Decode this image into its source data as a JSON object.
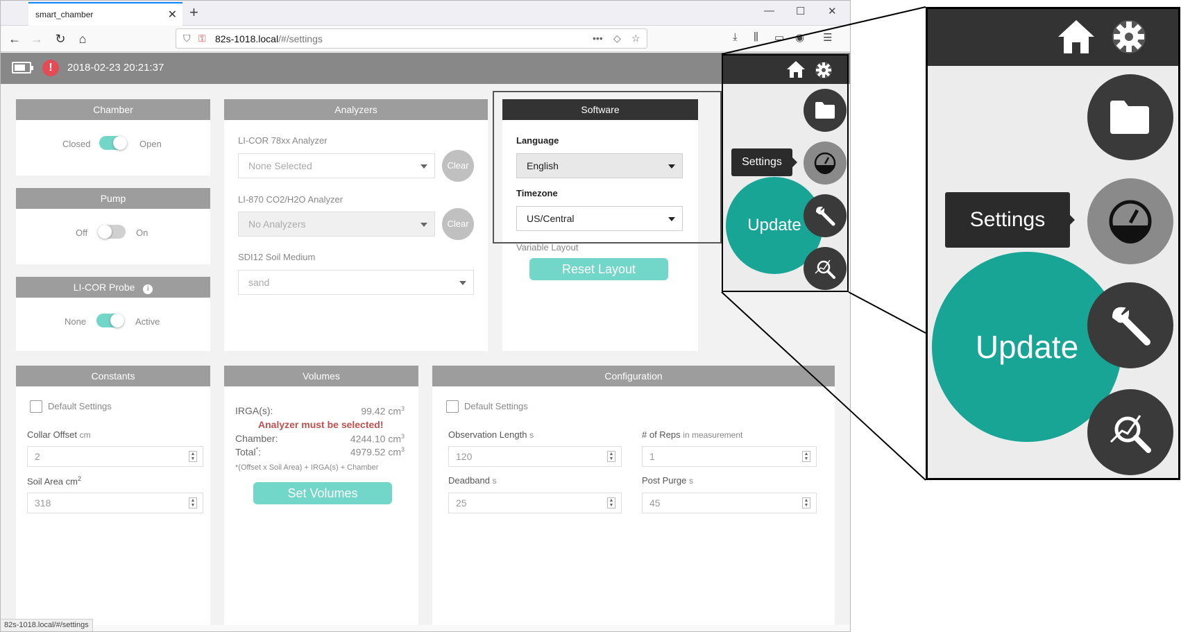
{
  "browser": {
    "tab_title": "smart_chamber",
    "tab_close": "✕",
    "new_tab": "+",
    "url_domain": "82s-1018.local",
    "url_path": "/#/settings",
    "status_url": "82s-1018.local/#/settings"
  },
  "header": {
    "datetime": "2018-02-23 20:21:37",
    "alert_symbol": "!"
  },
  "chamber": {
    "title": "Chamber",
    "left_label": "Closed",
    "right_label": "Open",
    "state": "on"
  },
  "pump": {
    "title": "Pump",
    "left_label": "Off",
    "right_label": "On",
    "state": "off"
  },
  "probe": {
    "title": "LI-COR Probe",
    "info": "i",
    "left_label": "None",
    "right_label": "Active",
    "state": "on"
  },
  "analyzers": {
    "title": "Analyzers",
    "a1_label": "LI-COR 78xx Analyzer",
    "a1_value": "None Selected",
    "a2_label": "LI-870 CO2/H2O Analyzer",
    "a2_value": "No Analyzers",
    "clear_label": "Clear",
    "soil_label": "SDI12 Soil Medium",
    "soil_value": "sand"
  },
  "software": {
    "title": "Software",
    "language_label": "Language",
    "language_value": "English",
    "timezone_label": "Timezone",
    "timezone_value": "US/Central",
    "variable_layout_label": "Variable Layout",
    "reset_label": "Reset Layout"
  },
  "constants": {
    "title": "Constants",
    "default_label": "Default Settings",
    "collar_label": "Collar Offset",
    "collar_unit": "cm",
    "collar_value": "2",
    "soil_area_label": "Soil Area",
    "soil_area_unit": "cm",
    "soil_area_sup": "2",
    "soil_area_value": "318"
  },
  "volumes": {
    "title": "Volumes",
    "irga_label": "IRGA(s):",
    "irga_value": "99.42",
    "warning": "Analyzer must be selected!",
    "chamber_label": "Chamber:",
    "chamber_value": "4244.10",
    "total_label": "Total",
    "total_value": "4979.52",
    "unit": "cm",
    "unit_sup": "3",
    "footnote": "*(Offset x Soil Area) + IRGA(s) + Chamber",
    "set_label": "Set Volumes"
  },
  "configuration": {
    "title": "Configuration",
    "default_label": "Default Settings",
    "obs_label": "Observation Length",
    "obs_unit": "s",
    "obs_value": "120",
    "reps_label": "# of Reps",
    "reps_suffix": "in measurement",
    "reps_value": "1",
    "deadband_label": "Deadband",
    "deadband_unit": "s",
    "deadband_value": "25",
    "postpurge_label": "Post Purge",
    "postpurge_unit": "s",
    "postpurge_value": "45"
  },
  "fab_menu": {
    "tooltip": "Settings",
    "update_label": "Update"
  },
  "colors": {
    "teal": "#18a596",
    "teal_light": "#72d6c9",
    "header_grey": "#888888",
    "dark": "#333333",
    "alert_red": "#e44c55"
  }
}
